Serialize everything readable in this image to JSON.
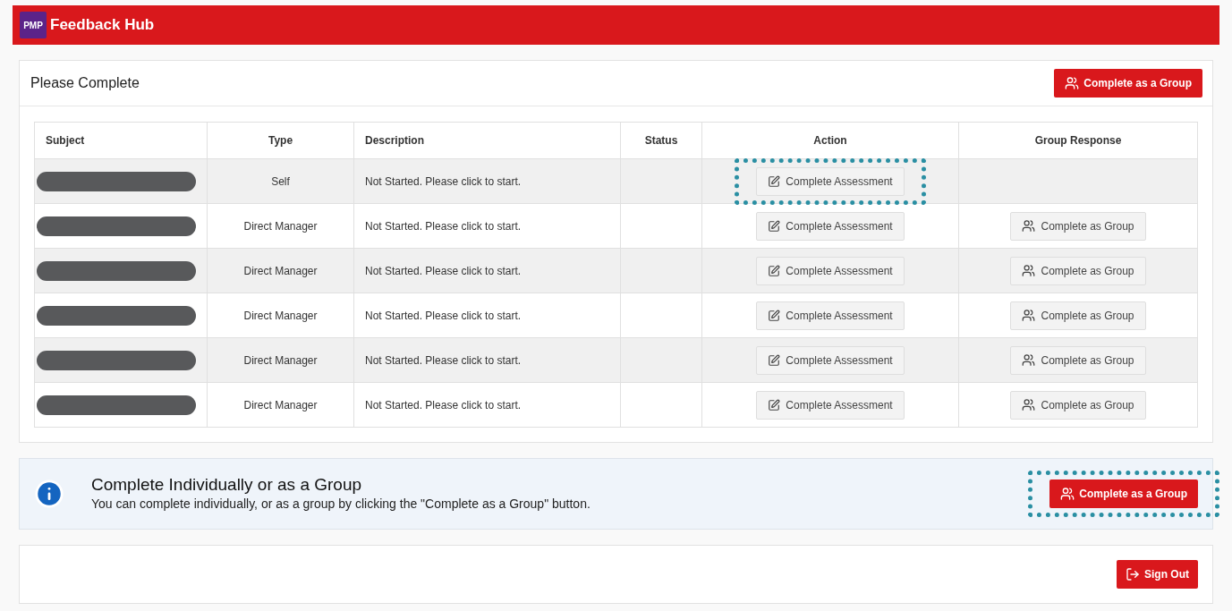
{
  "header": {
    "logo": "PMP",
    "title": "Feedback Hub"
  },
  "card": {
    "title": "Please Complete",
    "group_button": "Complete as a Group"
  },
  "table": {
    "columns": [
      "Subject",
      "Type",
      "Description",
      "Status",
      "Action",
      "Group Response"
    ],
    "rows": [
      {
        "type": "Self",
        "description": "Not Started. Please click to start.",
        "action": "Complete Assessment",
        "action_highlighted": true
      },
      {
        "type": "Direct Manager",
        "description": "Not Started. Please click to start.",
        "action": "Complete Assessment",
        "action_highlighted": false,
        "group": "Complete as Group"
      },
      {
        "type": "Direct Manager",
        "description": "Not Started. Please click to start.",
        "action": "Complete Assessment",
        "action_highlighted": false,
        "group": "Complete as Group"
      },
      {
        "type": "Direct Manager",
        "description": "Not Started. Please click to start.",
        "action": "Complete Assessment",
        "action_highlighted": false,
        "group": "Complete as Group"
      },
      {
        "type": "Direct Manager",
        "description": "Not Started. Please click to start.",
        "action": "Complete Assessment",
        "action_highlighted": false,
        "group": "Complete as Group"
      },
      {
        "type": "Direct Manager",
        "description": "Not Started. Please click to start.",
        "action": "Complete Assessment",
        "action_highlighted": false,
        "group": "Complete as Group"
      }
    ]
  },
  "info": {
    "title": "Complete Individually or as a Group",
    "text": "You can complete individually, or as a group by clicking the \"Complete as a Group\" button.",
    "button": "Complete as a Group",
    "button_highlighted": true
  },
  "footer": {
    "sign_out": "Sign Out"
  }
}
